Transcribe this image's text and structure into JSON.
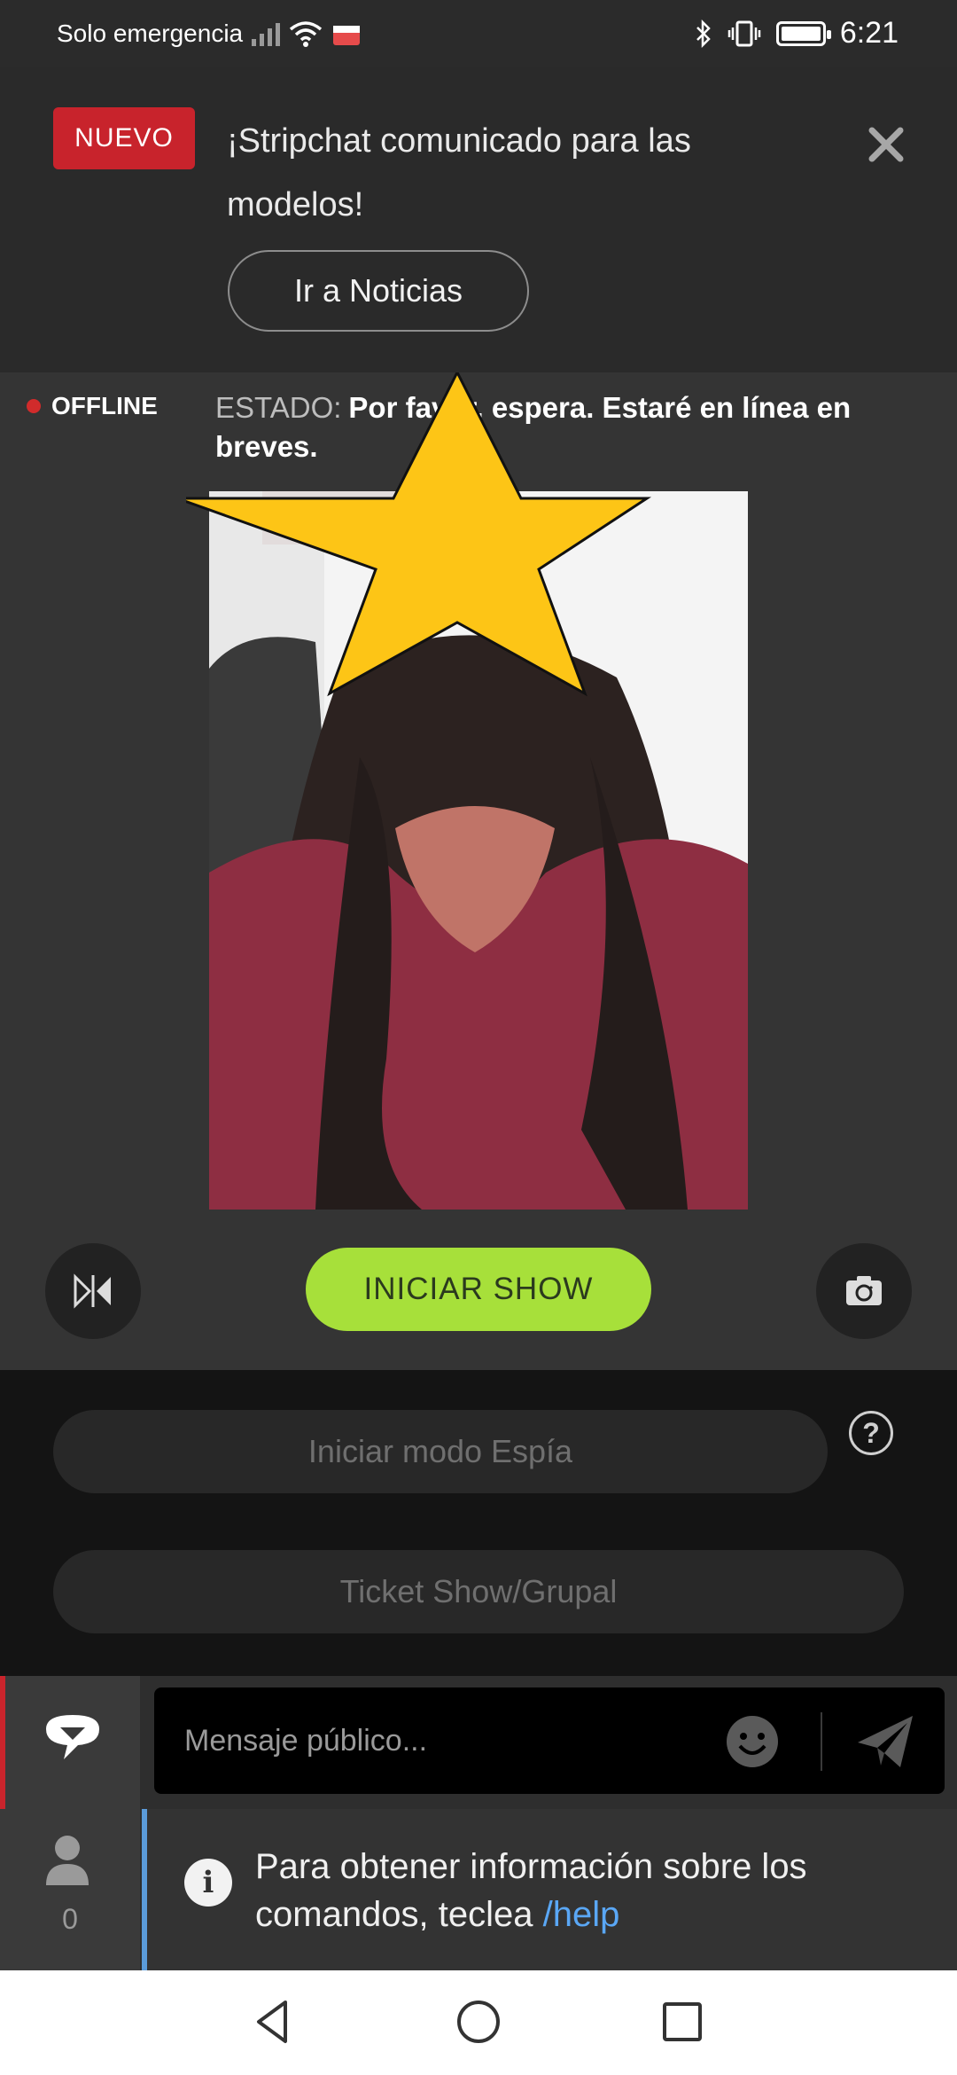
{
  "statusbar": {
    "carrier": "Solo emergencia",
    "time": "6:21"
  },
  "banner": {
    "badge": "NUEVO",
    "title": "¡Stripchat comunicado para las modelos!",
    "button": "Ir a Noticias"
  },
  "stream": {
    "offline_label": "OFFLINE",
    "status_label": "ESTADO:",
    "status_text": "Por favor, espera. Estaré en línea en breves.",
    "start_button": "INICIAR SHOW"
  },
  "options": {
    "spy_button": "Iniciar modo Espía",
    "ticket_button": "Ticket Show/Grupal",
    "help_icon_text": "?"
  },
  "chat": {
    "input_placeholder": "Mensaje público...",
    "user_count": "0",
    "info_text": "Para obtener información sobre los comandos, teclea",
    "info_command": "/help"
  },
  "colors": {
    "badge_red": "#c8232c",
    "start_green": "#a7e03a",
    "star_yellow": "#fdc516",
    "link_blue": "#5aa7f5"
  },
  "icons": [
    "wifi-icon",
    "signal-icon",
    "bluetooth-icon",
    "vibrate-icon",
    "battery-icon",
    "close-icon",
    "flip-icon",
    "camera-rotate-icon",
    "help-icon",
    "chat-icon",
    "emoji-icon",
    "send-icon",
    "user-icon",
    "info-icon",
    "back-icon",
    "home-icon",
    "recents-icon"
  ]
}
